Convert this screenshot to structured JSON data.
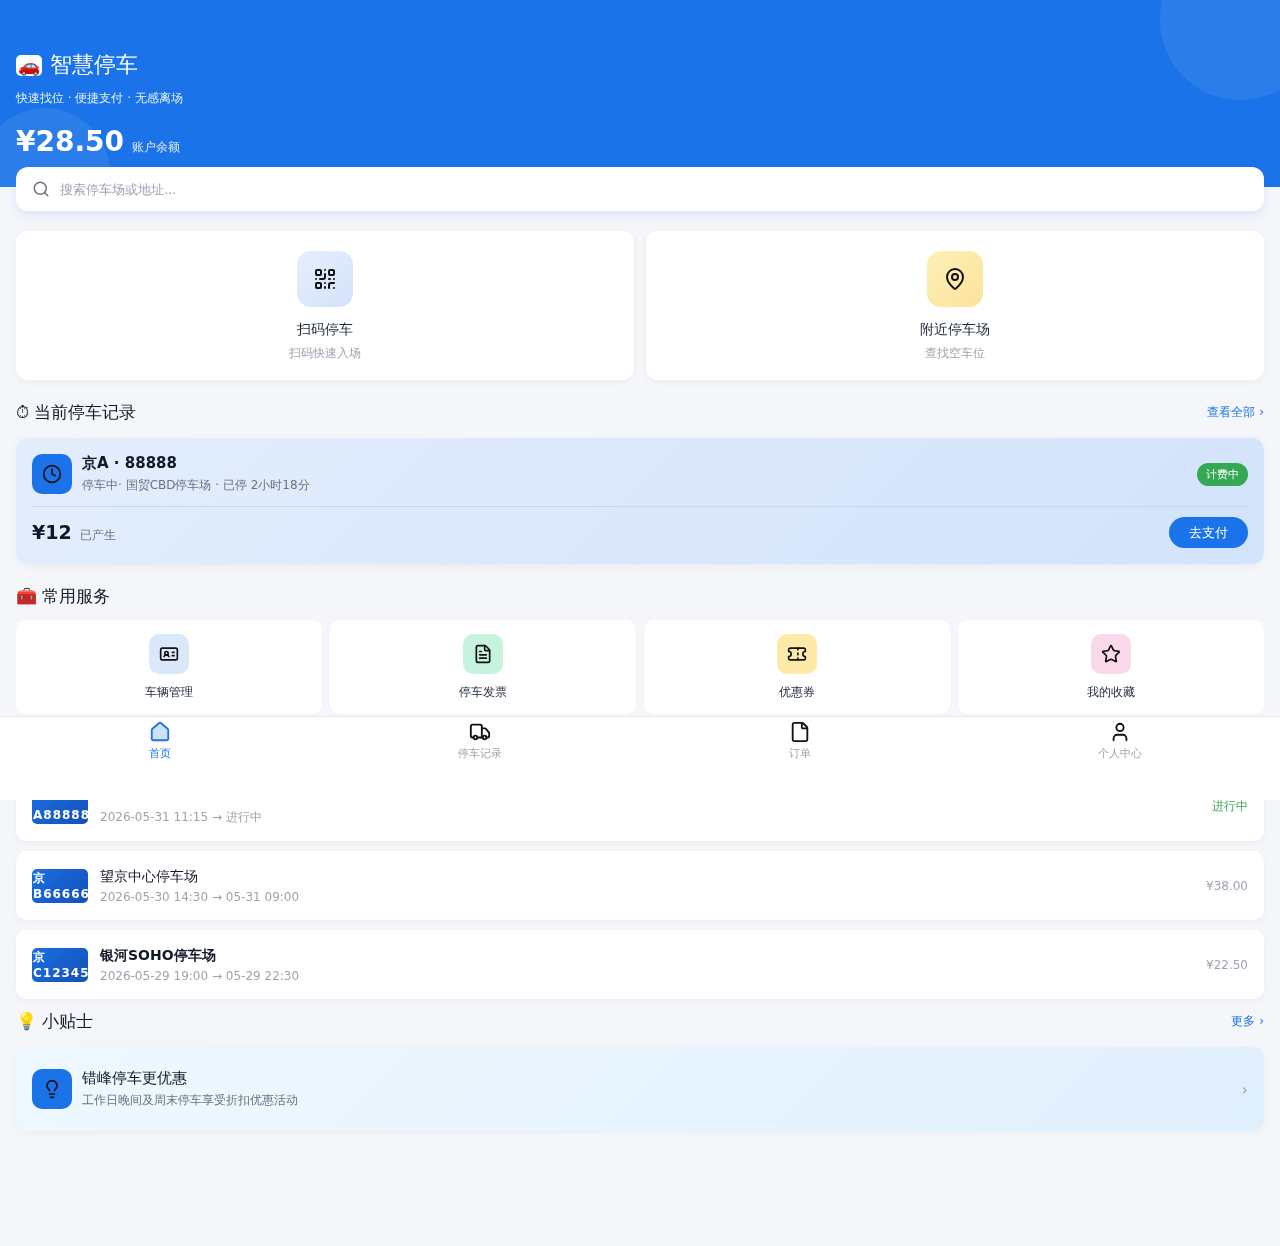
{
  "header": {
    "icon": "🚗",
    "title": "智慧停车",
    "subtitle": "快速找位 · 便捷支付 · 无感离场",
    "balance": "¥28.50",
    "balance_label": "账户余额"
  },
  "search": {
    "placeholder": "搜索停车场或地址..."
  },
  "actions": [
    {
      "title": "扫码停车",
      "subtitle": "扫码快速入场"
    },
    {
      "title": "附近停车场",
      "subtitle": "查找空车位"
    }
  ],
  "current": {
    "icon": "⏱",
    "title": "当前停车记录",
    "link": "查看全部 ›",
    "plate": "京A · 88888",
    "detail": "停车中· 国贸CBD停车场 · 已停 2小时18分",
    "badge": "计费中",
    "amount": "¥12",
    "amount_label": "已产生",
    "button": "去支付"
  },
  "services": {
    "icon": "🧰",
    "title": "常用服务",
    "items": [
      {
        "label": "车辆管理"
      },
      {
        "label": "停车发票"
      },
      {
        "label": "优惠券"
      },
      {
        "label": "我的收藏"
      }
    ]
  },
  "records": [
    {
      "plate": "A88888",
      "time": "2026-05-31 11:15 → 进行中",
      "value": "进行中",
      "kind": "ongoing"
    },
    {
      "plate_region": "京",
      "plate": "B66666",
      "title": "望京中心停车场",
      "time": "2026-05-30 14:30 → 05-31 09:00",
      "value": "¥38.00",
      "kind": "paid"
    },
    {
      "plate_region": "京",
      "plate": "C12345",
      "title": "银河SOHO停车场",
      "time": "2026-05-29 19:00 → 05-29 22:30",
      "value": "¥22.50",
      "kind": "paid"
    }
  ],
  "tips": {
    "icon": "💡",
    "title": "小贴士",
    "link": "更多 ›",
    "card_title": "错峰停车更优惠",
    "card_text": "工作日晚间及周末停车享受折扣优惠活动",
    "chevron": "›"
  },
  "nav": [
    {
      "label": "首页",
      "selected": true
    },
    {
      "label": "停车记录",
      "selected": false
    },
    {
      "label": "订单",
      "selected": false
    },
    {
      "label": "个人中心",
      "selected": false
    }
  ]
}
